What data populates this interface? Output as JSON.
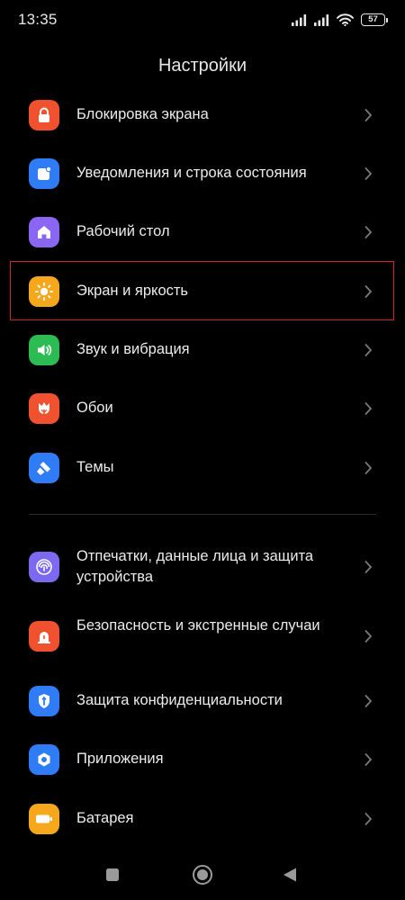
{
  "status_bar": {
    "time": "13:35",
    "battery_level": "57"
  },
  "header": {
    "title": "Настройки"
  },
  "settings": {
    "items": [
      {
        "label": "Блокировка экрана",
        "icon": "lock-icon",
        "color": "#f0522f"
      },
      {
        "label": "Уведомления и строка состояния",
        "icon": "notification-icon",
        "color": "#2f7cf6"
      },
      {
        "label": "Рабочий стол",
        "icon": "home-icon",
        "color": "#8a66f2"
      },
      {
        "label": "Экран и яркость",
        "icon": "sun-icon",
        "color": "#f5a81c"
      },
      {
        "label": "Звук и вибрация",
        "icon": "speaker-icon",
        "color": "#2dbb54"
      },
      {
        "label": "Обои",
        "icon": "tulip-icon",
        "color": "#f0522f"
      },
      {
        "label": "Темы",
        "icon": "brush-icon",
        "color": "#2f7cf6"
      },
      {
        "label": "Отпечатки, данные лица и защита устройства",
        "icon": "fingerprint-icon",
        "color": "#7d68f0"
      },
      {
        "label": "Безопасность и экстренные случаи",
        "icon": "siren-icon",
        "color": "#f0522f"
      },
      {
        "label": "Защита конфиденциальности",
        "icon": "privacy-shield-icon",
        "color": "#2f7cf6"
      },
      {
        "label": "Приложения",
        "icon": "apps-gear-icon",
        "color": "#2f7cf6"
      },
      {
        "label": "Батарея",
        "icon": "battery-icon",
        "color": "#f5a81c"
      }
    ]
  },
  "navigation": {
    "buttons": [
      "recents-button",
      "home-button",
      "back-button"
    ]
  }
}
